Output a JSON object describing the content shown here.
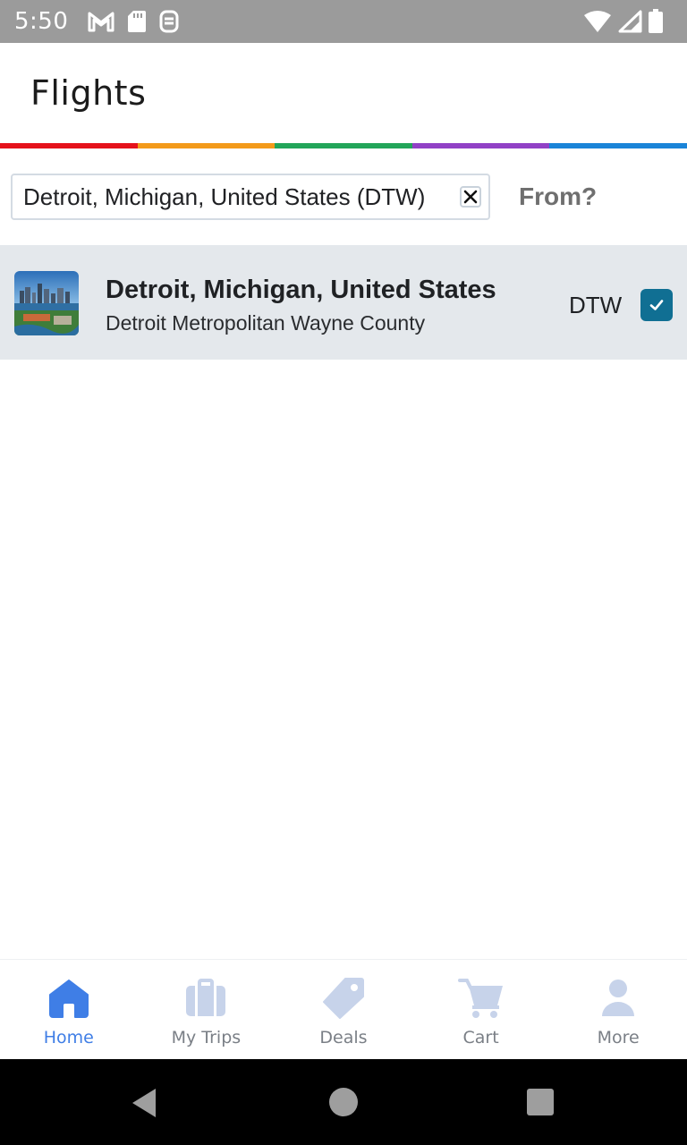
{
  "status_bar": {
    "time": "5:50",
    "left_icons": [
      "gmail-icon",
      "sd-card-icon",
      "app-notification-icon"
    ],
    "right_icons": [
      "wifi-icon",
      "cell-signal-icon",
      "battery-icon"
    ]
  },
  "header": {
    "title": "Flights"
  },
  "stripe_colors": [
    "#e5121b",
    "#f39a1a",
    "#22a559",
    "#9141c6",
    "#1a84d8"
  ],
  "search": {
    "value": "Detroit, Michigan, United States (DTW)",
    "clear_icon": "close-icon",
    "from_label": "From?"
  },
  "results": [
    {
      "title": "Detroit, Michigan, United States",
      "subtitle": "Detroit Metropolitan Wayne County",
      "code": "DTW",
      "selected": true,
      "thumbnail": "city-skyline-image"
    }
  ],
  "bottom_nav": {
    "items": [
      {
        "label": "Home",
        "icon": "home-icon",
        "active": true
      },
      {
        "label": "My Trips",
        "icon": "suitcase-icon",
        "active": false
      },
      {
        "label": "Deals",
        "icon": "tag-icon",
        "active": false
      },
      {
        "label": "Cart",
        "icon": "cart-icon",
        "active": false
      },
      {
        "label": "More",
        "icon": "person-icon",
        "active": false
      }
    ]
  },
  "colors": {
    "accent_active": "#3f7ee6",
    "icon_inactive": "#c7d3ea",
    "checkbox": "#106f93",
    "result_bg": "#e4e8ec"
  }
}
